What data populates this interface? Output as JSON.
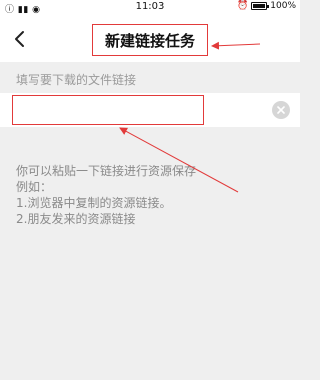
{
  "status_bar": {
    "left_icons": "ⓘ ▮▮ ◉",
    "time": "11:03",
    "battery_percent": "100%"
  },
  "header": {
    "title": "新建链接任务"
  },
  "form": {
    "label": "填写要下载的文件链接",
    "input_value": "",
    "input_placeholder": ""
  },
  "hint": {
    "line1": "你可以粘贴一下链接进行资源保存",
    "line2": "例如：",
    "line3": "1.浏览器中复制的资源链接。",
    "line4": "2.朋友发来的资源链接"
  },
  "colors": {
    "annotation": "#e23a3a",
    "background": "#efefef"
  }
}
